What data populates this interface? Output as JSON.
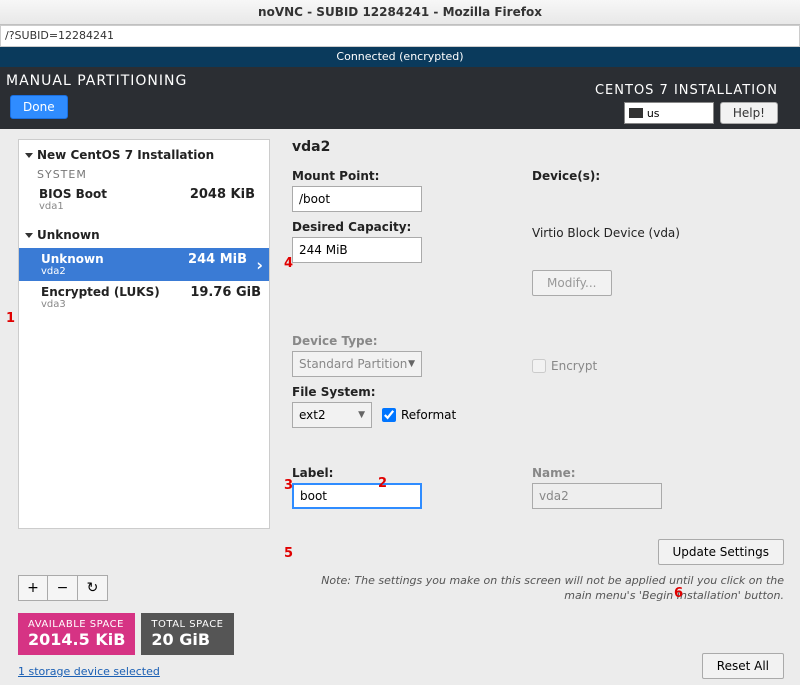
{
  "window": {
    "title": "noVNC - SUBID 12284241 - Mozilla Firefox"
  },
  "url": "/?SUBID=12284241",
  "vnc_status": "Connected (encrypted)",
  "header": {
    "title": "MANUAL PARTITIONING",
    "done": "Done",
    "install_title": "CENTOS 7 INSTALLATION",
    "keyboard": "us",
    "help": "Help!"
  },
  "tree": {
    "section1": {
      "title": "New CentOS 7 Installation",
      "subtitle": "SYSTEM"
    },
    "row_bios": {
      "name": "BIOS Boot",
      "dev": "vda1",
      "size": "2048 KiB"
    },
    "section2": {
      "title": "Unknown"
    },
    "row_unknown": {
      "name": "Unknown",
      "dev": "vda2",
      "size": "244 MiB"
    },
    "row_luks": {
      "name": "Encrypted (LUKS)",
      "dev": "vda3",
      "size": "19.76 GiB"
    },
    "buttons": {
      "add": "+",
      "remove": "−",
      "reload": "↻"
    }
  },
  "detail": {
    "heading": "vda2",
    "mount_point_label": "Mount Point:",
    "mount_point": "/boot",
    "capacity_label": "Desired Capacity:",
    "capacity": "244 MiB",
    "devices_label": "Device(s):",
    "device_text": "Virtio Block Device (vda)",
    "modify": "Modify...",
    "device_type_label": "Device Type:",
    "device_type": "Standard Partition",
    "encrypt_label": "Encrypt",
    "fs_label": "File System:",
    "fs": "ext2",
    "reformat_label": "Reformat",
    "label_label": "Label:",
    "label": "boot",
    "name_label": "Name:",
    "name": "vda2",
    "update": "Update Settings",
    "note": "Note:  The settings you make on this screen will not be applied until you click on the main menu's 'Begin Installation' button."
  },
  "footer": {
    "avail_label": "AVAILABLE SPACE",
    "avail_val": "2014.5 KiB",
    "total_label": "TOTAL SPACE",
    "total_val": "20 GiB",
    "storage_link": "1 storage device selected",
    "reset": "Reset All"
  },
  "annotations": {
    "a1": "1",
    "a2": "2",
    "a3": "3",
    "a4": "4",
    "a5": "5",
    "a6": "6"
  }
}
